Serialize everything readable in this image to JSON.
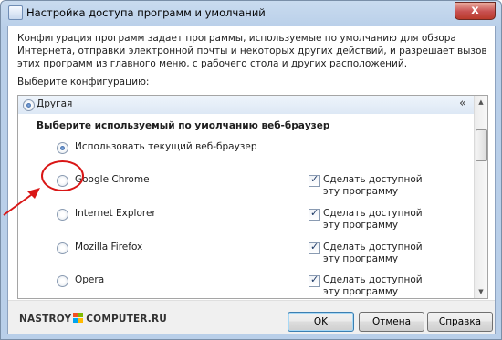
{
  "window": {
    "title": "Настройка доступа программ и умолчаний",
    "close_glyph": "x"
  },
  "description": "Конфигурация программ задает программы, используемые по умолчанию для обзора Интернета, отправки электронной почты и некоторых других действий, и разрешает вызов этих программ из главного меню, с рабочего стола и других расположений.",
  "choose_config_label": "Выберите конфигурацию:",
  "config_group": {
    "label": "Другая",
    "selected": true,
    "collapse_glyph": "«"
  },
  "browser_section": {
    "title": "Выберите используемый по умолчанию веб-браузер",
    "current_option_label": "Использовать текущий веб-браузер",
    "current_option_selected": true,
    "make_available_label": "Сделать доступной эту программу",
    "browsers": [
      {
        "name": "Google Chrome",
        "selected": false,
        "make_available": true
      },
      {
        "name": "Internet Explorer",
        "selected": false,
        "make_available": true
      },
      {
        "name": "Mozilla Firefox",
        "selected": false,
        "make_available": true
      },
      {
        "name": "Opera",
        "selected": false,
        "make_available": true
      }
    ]
  },
  "scrollbar": {
    "up_glyph": "▲",
    "down_glyph": "▼"
  },
  "watermark": {
    "left": "NASTROY",
    "right": "COMPUTER.RU"
  },
  "buttons": {
    "ok": "OK",
    "cancel": "Отмена",
    "help": "Справка"
  },
  "colors": {
    "annotation": "#d91616",
    "accent": "#3c7fb1"
  }
}
